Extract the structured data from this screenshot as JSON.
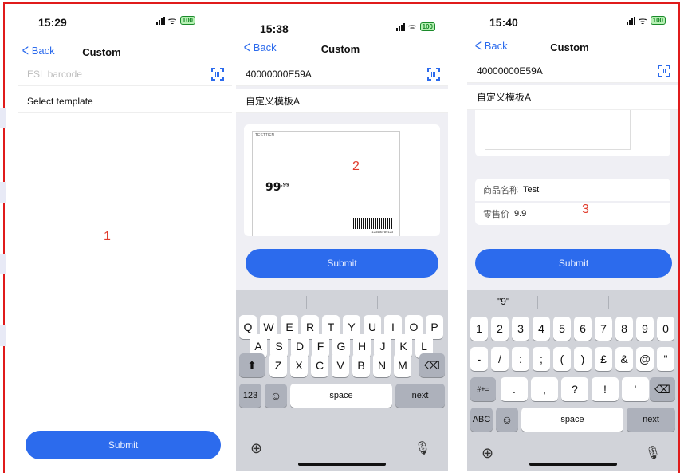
{
  "screens": [
    {
      "time": "15:29",
      "battery": "100",
      "nav": {
        "back": "Back",
        "title": "Custom"
      },
      "barcode_placeholder": "ESL barcode",
      "template_label": "Select template",
      "marker": "1",
      "submit": "Submit"
    },
    {
      "time": "15:38",
      "battery": "100",
      "nav": {
        "back": "Back",
        "title": "Custom"
      },
      "barcode_value": "40000000E59A",
      "template_value": "自定义模板A",
      "marker": "2",
      "preview": {
        "name": "TESTTIEN",
        "price": "99",
        "price_cents": ".99",
        "barcode_number": "123456789123"
      },
      "submit": "Submit",
      "keyboard": {
        "row1": [
          "Q",
          "W",
          "E",
          "R",
          "T",
          "Y",
          "U",
          "I",
          "O",
          "P"
        ],
        "row2": [
          "A",
          "S",
          "D",
          "F",
          "G",
          "H",
          "J",
          "K",
          "L"
        ],
        "row3": [
          "Z",
          "X",
          "C",
          "V",
          "B",
          "N",
          "M"
        ],
        "numbers_key": "123",
        "space": "space",
        "return": "next"
      }
    },
    {
      "time": "15:40",
      "battery": "100",
      "nav": {
        "back": "Back",
        "title": "Custom"
      },
      "barcode_value": "40000000E59A",
      "template_value": "自定义模板A",
      "fields": [
        {
          "label": "商品名称",
          "value": "Test"
        },
        {
          "label": "零售价",
          "value": "9.9"
        }
      ],
      "marker": "3",
      "submit": "Submit",
      "keyboard": {
        "suggestion": "\"9\"",
        "row1": [
          "1",
          "2",
          "3",
          "4",
          "5",
          "6",
          "7",
          "8",
          "9",
          "0"
        ],
        "row2": [
          "-",
          "/",
          ":",
          ";",
          "(",
          ")",
          "£",
          "&",
          "@",
          "\""
        ],
        "row3": [
          ".",
          ",",
          "?",
          "!",
          "'"
        ],
        "symbols_key": "#+=",
        "abc_key": "ABC",
        "space": "space",
        "return": "next"
      }
    }
  ]
}
